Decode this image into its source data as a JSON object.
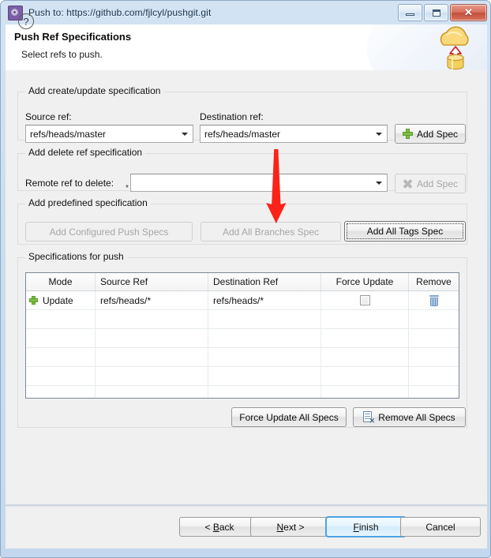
{
  "window": {
    "title": "Push to: https://github.com/fjlcyl/pushgit.git",
    "app_icon": "gear-icon",
    "controls": {
      "minimize": "minimize-icon",
      "maximize": "maximize-icon",
      "close": "✕"
    }
  },
  "header": {
    "title": "Push Ref Specifications",
    "subtitle": "Select refs to push.",
    "art_icon": "cloud-upload-database-icon"
  },
  "create_update": {
    "group_title": "Add create/update specification",
    "source_label": "Source ref:",
    "source_value": "refs/heads/master",
    "destination_label": "Destination ref:",
    "destination_value": "refs/heads/master",
    "add_spec_label": "Add Spec",
    "add_spec_icon": "green-plus-icon",
    "add_spec_enabled": true
  },
  "delete_ref": {
    "group_title": "Add delete ref specification",
    "remote_label": "Remote ref to delete:",
    "required_marker": "*",
    "remote_value": "",
    "add_spec_label": "Add Spec",
    "add_spec_icon": "grey-x-icon",
    "add_spec_enabled": false
  },
  "predefined": {
    "group_title": "Add predefined specification",
    "buttons": [
      {
        "label": "Add Configured Push Specs",
        "enabled": false,
        "focused": false
      },
      {
        "label": "Add All Branches Spec",
        "enabled": false,
        "focused": false
      },
      {
        "label": "Add All Tags Spec",
        "enabled": true,
        "focused": true
      }
    ]
  },
  "specs": {
    "group_title": "Specifications for push",
    "columns": [
      "Mode",
      "Source Ref",
      "Destination Ref",
      "Force Update",
      "Remove"
    ],
    "rows": [
      {
        "mode_icon": "green-plus-icon",
        "mode": "Update",
        "source_ref": "refs/heads/*",
        "destination_ref": "refs/heads/*",
        "force_update": false,
        "remove_icon": "trash-icon"
      }
    ],
    "empty_row_count": 5,
    "force_update_all_label": "Force Update All Specs",
    "remove_all_label": "Remove All Specs",
    "remove_all_icon": "document-remove-icon"
  },
  "footer": {
    "help_icon": "?",
    "buttons": [
      {
        "name": "back",
        "pre": "< ",
        "mnemonic": "B",
        "post": "ack",
        "primary": false
      },
      {
        "name": "next",
        "pre": "",
        "mnemonic": "N",
        "post": "ext >",
        "primary": false
      },
      {
        "name": "finish",
        "pre": "",
        "mnemonic": "F",
        "post": "inish",
        "primary": true
      },
      {
        "name": "cancel",
        "pre": "",
        "mnemonic": "",
        "post": "Cancel",
        "primary": false
      }
    ]
  },
  "annotation": {
    "arrow_color": "#fb2318",
    "points_to": "Add All Branches Spec"
  },
  "colors": {
    "window_frame": "#c5d9ed",
    "content_bg": "#f0f0f0",
    "accent_blue": "#4ba3e3",
    "plus_green": "#7bc043",
    "annotation_red": "#fb2318"
  }
}
